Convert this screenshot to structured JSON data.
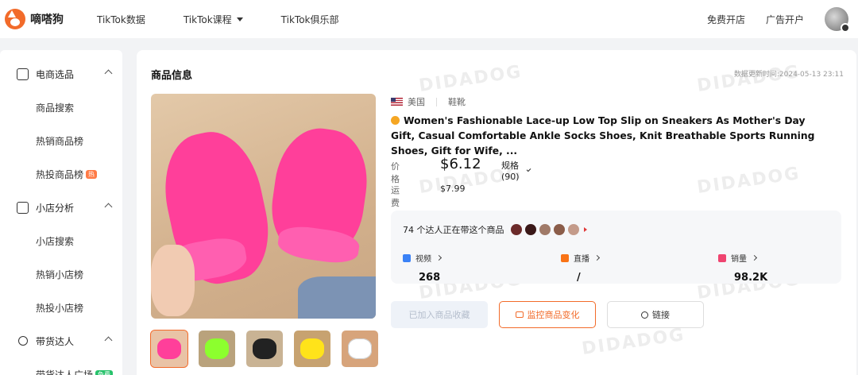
{
  "app": {
    "brand": "嘀嗒狗"
  },
  "nav": {
    "items": [
      {
        "label": "TikTok数据",
        "has_dropdown": false
      },
      {
        "label": "TikTok课程",
        "has_dropdown": true
      },
      {
        "label": "TikTok俱乐部",
        "has_dropdown": false
      }
    ],
    "right": {
      "open_store": "免费开店",
      "ad_account": "广告开户"
    }
  },
  "sidebar": {
    "groups": [
      {
        "label": "电商选品",
        "icon": "shopping-bag-icon",
        "expanded": true,
        "items": [
          {
            "label": "商品搜索"
          },
          {
            "label": "热销商品榜"
          },
          {
            "label": "热投商品榜",
            "tag": "热"
          }
        ]
      },
      {
        "label": "小店分析",
        "icon": "store-icon",
        "expanded": true,
        "items": [
          {
            "label": "小店搜索"
          },
          {
            "label": "热销小店榜"
          },
          {
            "label": "热投小店榜"
          }
        ]
      },
      {
        "label": "带货达人",
        "icon": "person-icon",
        "expanded": true,
        "items": [
          {
            "label": "带货达人广场",
            "tag": "免费"
          }
        ]
      }
    ]
  },
  "product": {
    "section_title": "商品信息",
    "updated_at": "数据更新时间:2024-05-13 23:11",
    "region": "美国",
    "category": "鞋靴",
    "title": "Women's Fashionable Lace-up Low Top Slip on Sneakers As Mother's Day Gift, Casual Comfortable Ankle Socks Shoes, Knit Breathable Sports Running Shoes, Gift for Wife, ...",
    "price_label": "价格",
    "price": "$6.12",
    "spec": "规格(90)",
    "shipping_label": "运费",
    "shipping": "$7.99",
    "thumbnail_colors": [
      "#ff3f9a",
      "#8cff2e",
      "#222222",
      "#ffe31a",
      "#ffffff"
    ],
    "thumbnail_bg": [
      "#e9c3a6",
      "#b9a27c",
      "#c9b394",
      "#c7a270",
      "#d7a47b"
    ]
  },
  "creators": {
    "text": "74 个达人正在带这个商品",
    "avatar_colors": [
      "#6b2a2a",
      "#3a1818",
      "#a07a68",
      "#8b5d4a",
      "#c49b8a"
    ]
  },
  "stats": [
    {
      "label": "视频",
      "value": "268",
      "icon": "video-icon",
      "color": "#3b82f6"
    },
    {
      "label": "直播",
      "value": "/",
      "icon": "live-icon",
      "color": "#f97316"
    },
    {
      "label": "销量",
      "value": "98.2K",
      "icon": "sales-chart-icon",
      "color": "#ef4470"
    }
  ],
  "actions": {
    "favorite": "已加入商品收藏",
    "monitor": "监控商品变化",
    "link": "链接"
  },
  "watermark": "DIDADOG"
}
